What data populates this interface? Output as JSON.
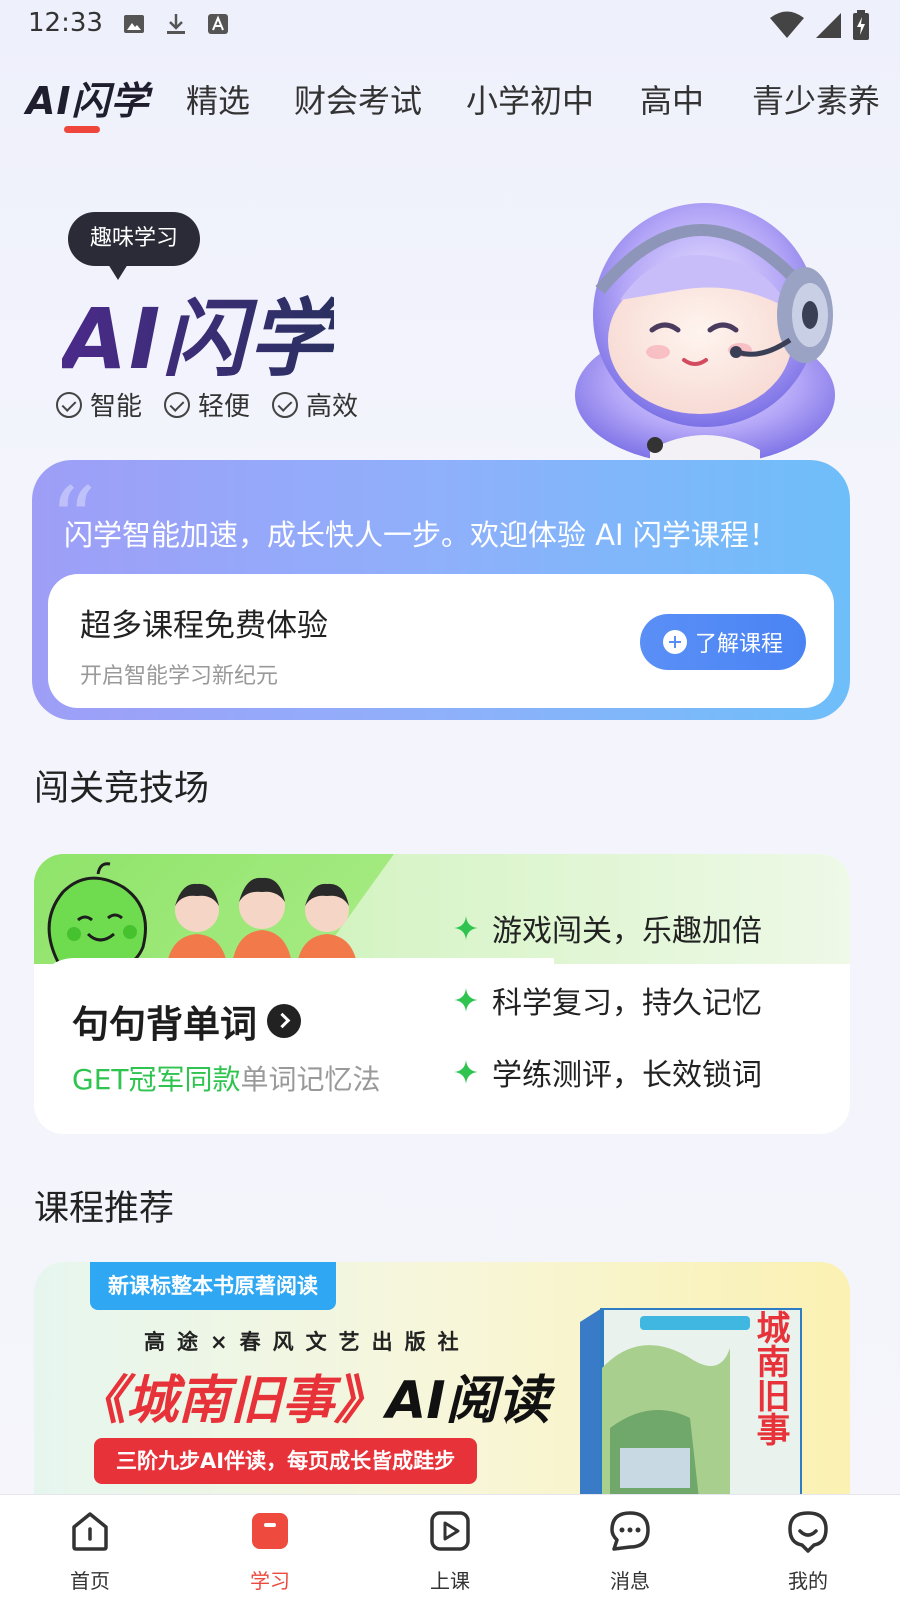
{
  "status_bar": {
    "time": "12:33"
  },
  "top_tabs": {
    "logo": "AI闪学",
    "tabs": [
      "精选",
      "财会考试",
      "小学初中",
      "高中",
      "青少素养"
    ]
  },
  "hero": {
    "bubble": "趣味学习",
    "title": "AI闪学",
    "features": [
      "智能",
      "轻便",
      "高效"
    ]
  },
  "promo": {
    "headline": "闪学智能加速，成长快人一步。欢迎体验 AI 闪学课程！",
    "card_title": "超多课程免费体验",
    "card_subtitle": "开启智能学习新纪元",
    "button_label": "了解课程"
  },
  "challenge_section": {
    "title": "闯关竞技场"
  },
  "vocab_card": {
    "title": "句句背单词",
    "subtitle_prefix": "GET冠军同款",
    "subtitle_suffix": "单词记忆法",
    "points": [
      "游戏闯关，乐趣加倍",
      "科学复习，持久记忆",
      "学练测评，长效锁词"
    ]
  },
  "course_section": {
    "title": "课程推荐"
  },
  "course_banner": {
    "tag": "新课标整本书原著阅读",
    "publisher": "高途×春风文艺出版社",
    "title_red": "《城南旧事》",
    "title_black": "AI阅读",
    "slogan": "三阶九步AI伴读，每页成长皆成跬步",
    "book_title": "城南旧事"
  },
  "bottom_nav": {
    "items": [
      {
        "label": "首页",
        "icon": "home-icon"
      },
      {
        "label": "学习",
        "icon": "study-icon"
      },
      {
        "label": "上课",
        "icon": "play-icon"
      },
      {
        "label": "消息",
        "icon": "message-icon"
      },
      {
        "label": "我的",
        "icon": "profile-icon"
      }
    ],
    "active_index": 1
  },
  "colors": {
    "accent_red": "#f0453a",
    "promo_blue": "#4a84f4",
    "green": "#2ec44f"
  }
}
